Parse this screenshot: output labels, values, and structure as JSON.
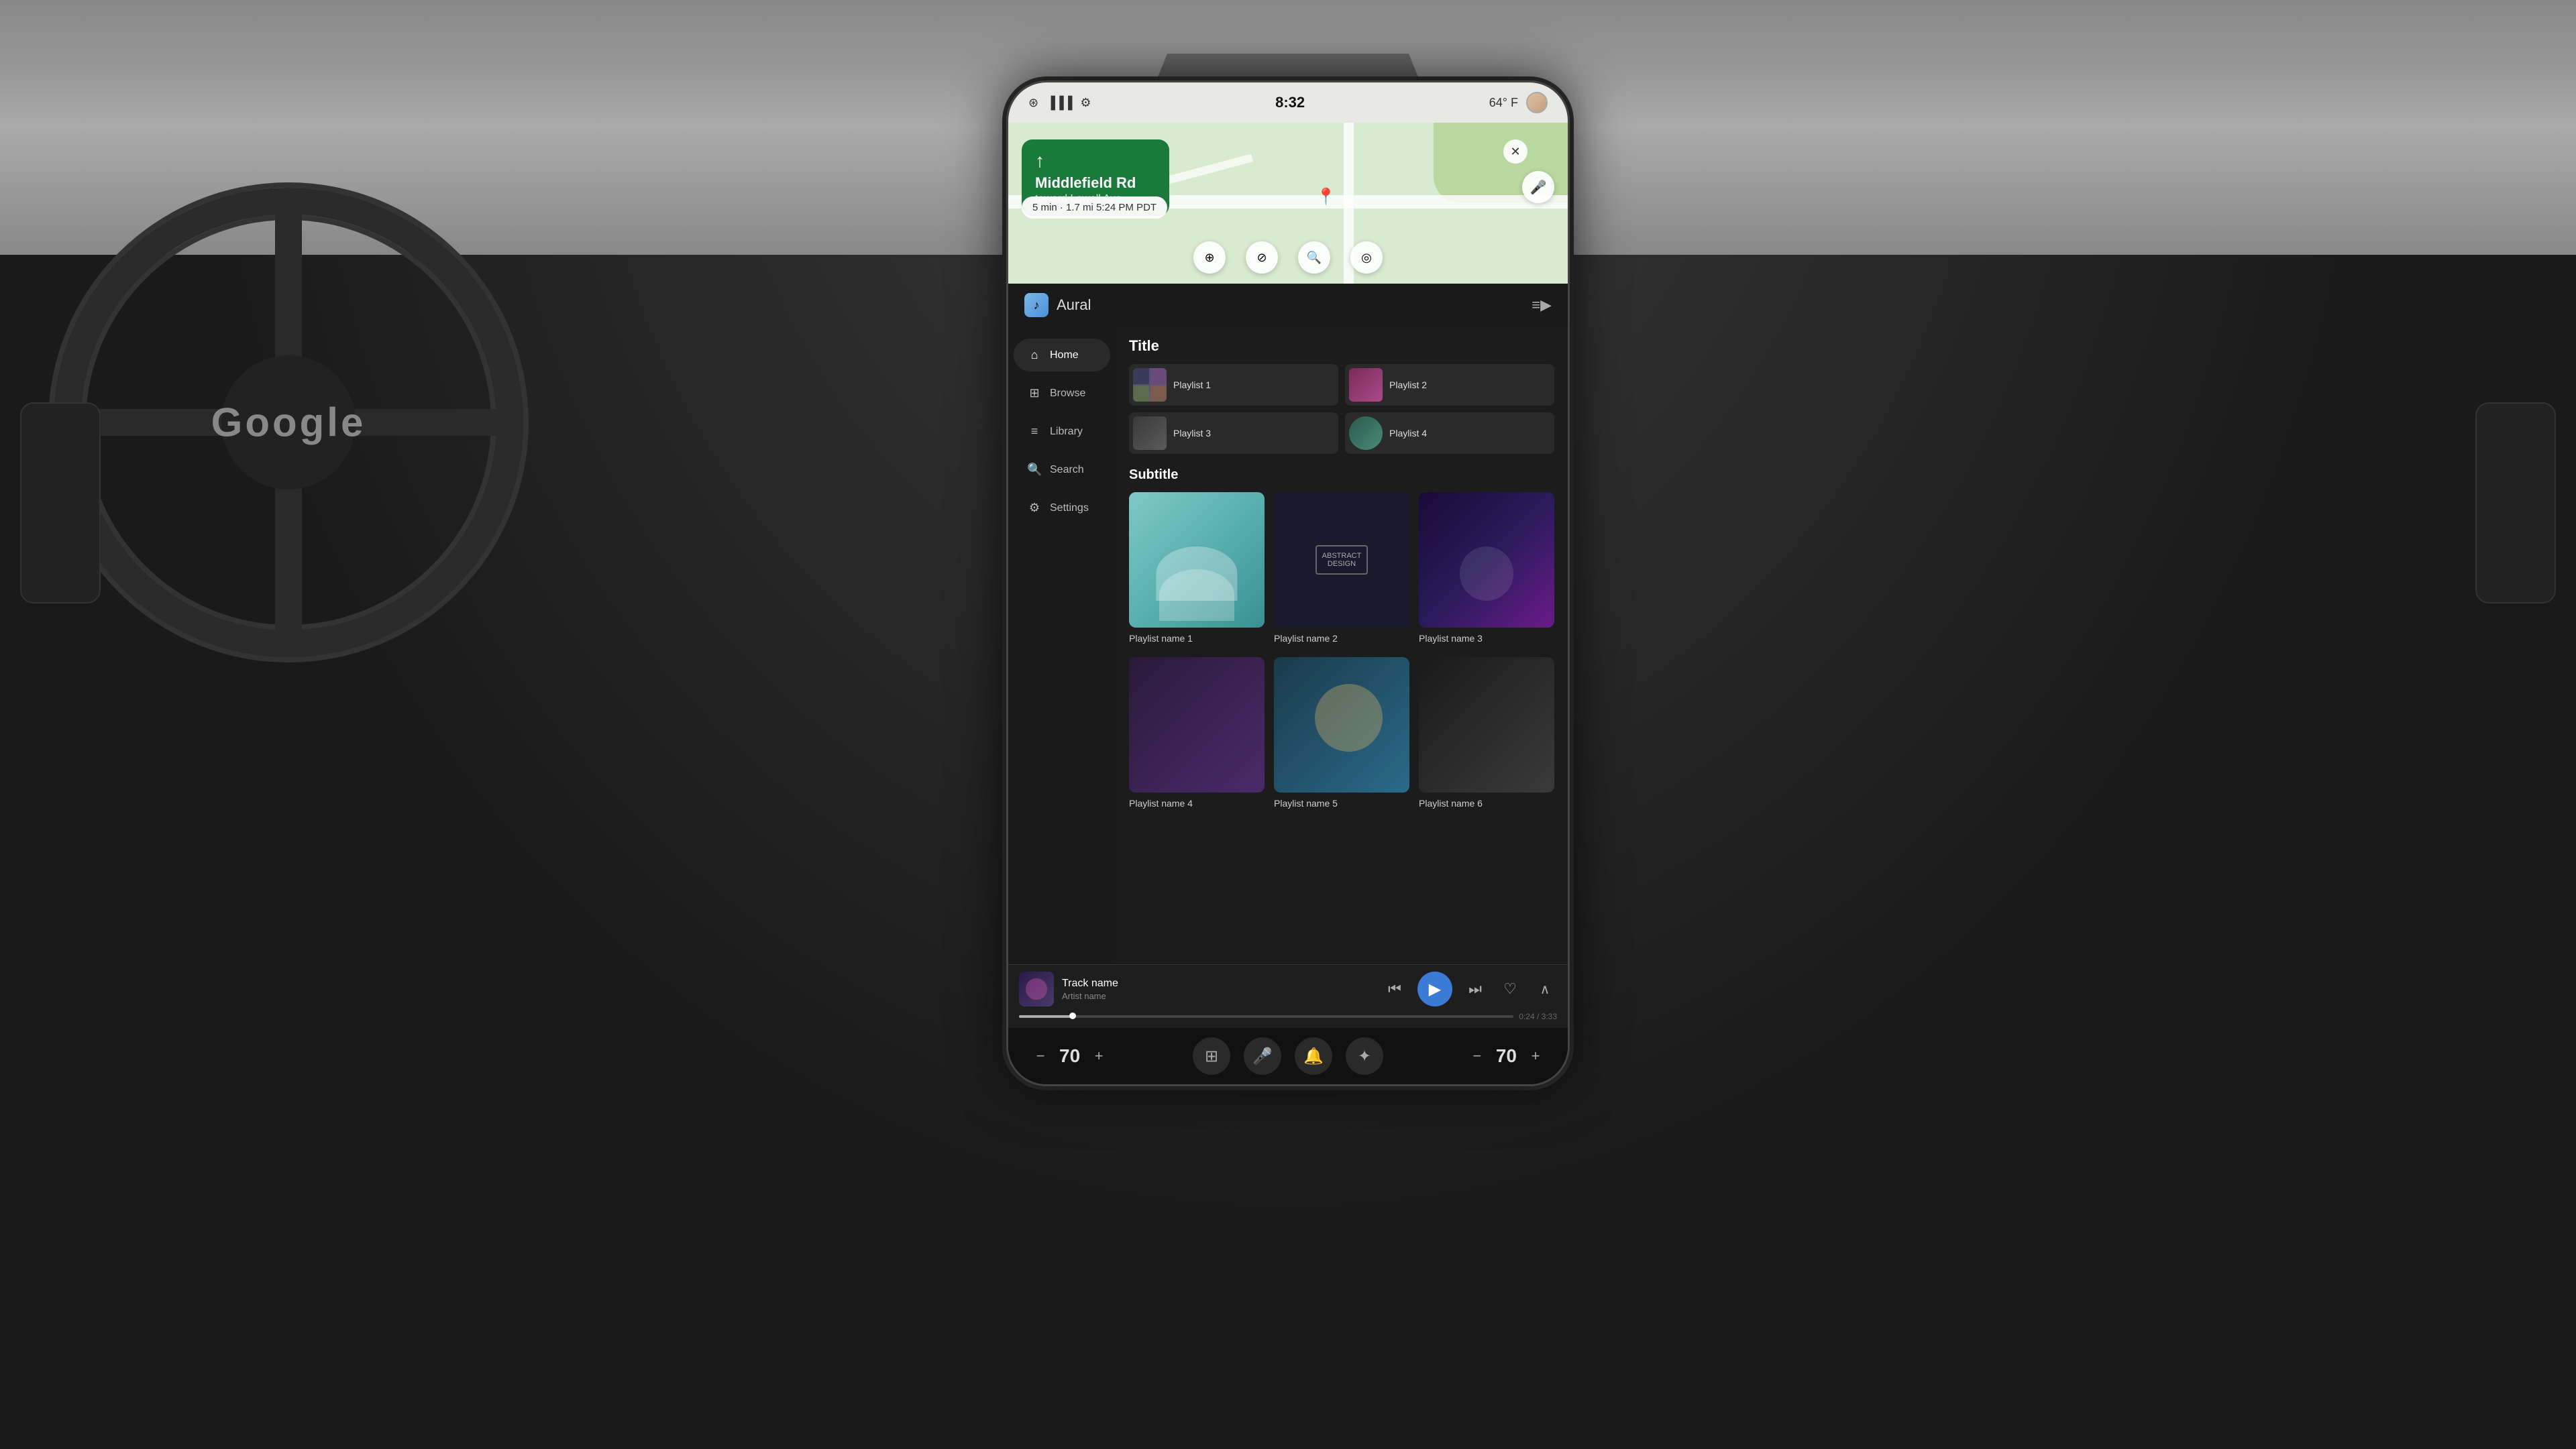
{
  "car": {
    "google_logo": "Google"
  },
  "status_bar": {
    "time": "8:32",
    "temperature": "64° F",
    "bluetooth_icon": "⊕",
    "signal_icon": "📶",
    "settings_icon": "⚙"
  },
  "navigation": {
    "street": "Middlefield Rd",
    "toward": "toward Lowell Ave",
    "arrow": "↑",
    "eta": "5 min · 1.7 mi",
    "eta_time": "5:24 PM PDT",
    "map_controls": [
      "⊕",
      "⊘",
      "🔍",
      "⊙"
    ]
  },
  "app": {
    "name": "Aural",
    "section_title": "Title",
    "section_subtitle": "Subtitle"
  },
  "sidebar": {
    "items": [
      {
        "label": "Home",
        "icon": "⌂",
        "active": true
      },
      {
        "label": "Browse",
        "icon": "⊞"
      },
      {
        "label": "Library",
        "icon": "≡"
      },
      {
        "label": "Search",
        "icon": "🔍"
      },
      {
        "label": "Settings",
        "icon": "⚙"
      }
    ]
  },
  "playlists_small": [
    {
      "name": "Playlist 1",
      "thumb_class": "thumb-1"
    },
    {
      "name": "Playlist 2",
      "thumb_class": "thumb-2"
    },
    {
      "name": "Playlist 3",
      "thumb_class": "thumb-3"
    },
    {
      "name": "Playlist 4",
      "thumb_class": "thumb-4"
    }
  ],
  "playlists_large_row1": [
    {
      "name": "Playlist name 1",
      "thumb_class": "card-thumb-1"
    },
    {
      "name": "Playlist name 2",
      "thumb_class": "card-thumb-2"
    },
    {
      "name": "Playlist name 3",
      "thumb_class": "card-thumb-3"
    }
  ],
  "playlists_large_row2": [
    {
      "name": "Playlist name 4",
      "thumb_class": "card-thumb-row2-1"
    },
    {
      "name": "Playlist name 5",
      "thumb_class": "card-thumb-row2-2"
    },
    {
      "name": "Playlist name 6",
      "thumb_class": "card-thumb-row2-3"
    }
  ],
  "now_playing": {
    "track_name": "Track name",
    "artist_name": "Artist name",
    "progress_current": "0:24",
    "progress_total": "3:33",
    "progress_percent": 11
  },
  "volume_left": {
    "minus": "−",
    "value": "70",
    "plus": "+"
  },
  "volume_right": {
    "minus": "−",
    "value": "70",
    "plus": "+"
  },
  "bottom_icons": [
    "⊞",
    "🎤",
    "🔔",
    "✦"
  ],
  "controls": {
    "prev_icon": "⏮",
    "play_icon": "▶",
    "next_icon": "⏭",
    "love_icon": "♡",
    "expand_icon": "∧"
  }
}
